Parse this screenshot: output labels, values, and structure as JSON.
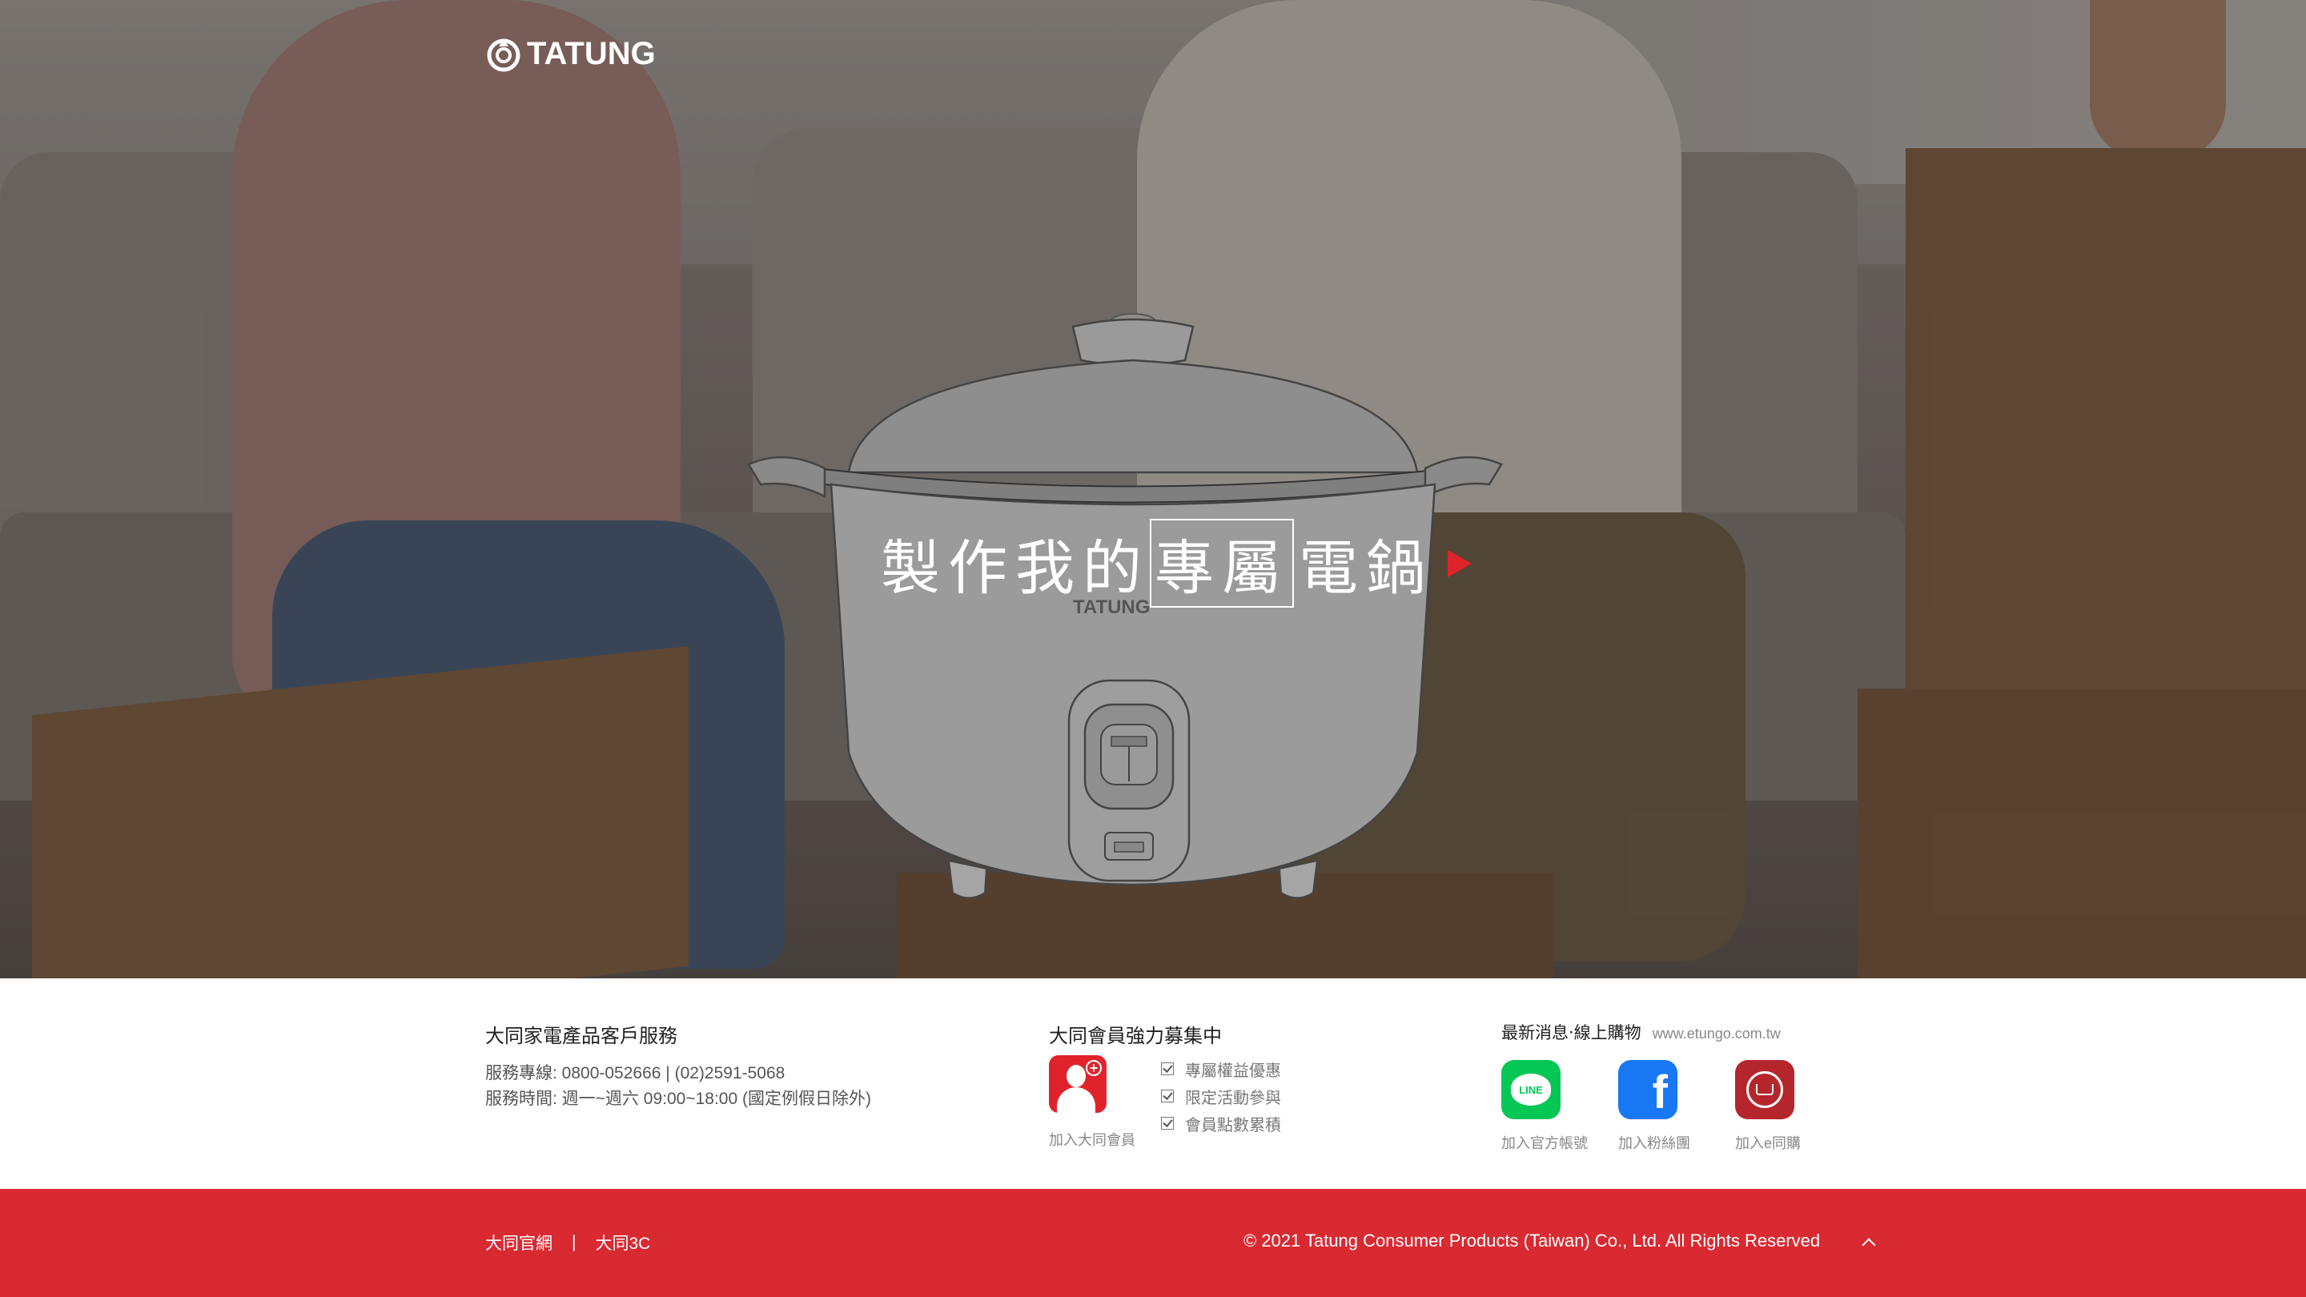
{
  "brand": {
    "name": "TATUNG"
  },
  "hero": {
    "title_prefix": "製作我的",
    "title_highlight": "專屬",
    "title_suffix": "電鍋",
    "cooker_logo": "TATUNG",
    "cta_icon": "play-triangle-icon"
  },
  "service": {
    "title": "大同家電產品客戶服務",
    "hotline": "服務專線: 0800-052666 | (02)2591-5068",
    "hours": "服務時間: 週一~週六 09:00~18:00 (國定例假日除外)"
  },
  "membership": {
    "title": "大同會員強力募集中",
    "join_label": "加入大同會員",
    "perks": [
      "專屬權益優惠",
      "限定活動參與",
      "會員點數累積"
    ]
  },
  "social": {
    "title": "最新消息‧線上購物",
    "url": "www.etungo.com.tw",
    "items": [
      {
        "label": "加入官方帳號",
        "icon": "line-icon"
      },
      {
        "label": "加入粉絲團",
        "icon": "facebook-icon"
      },
      {
        "label": "加入e同購",
        "icon": "shopping-cart-icon"
      }
    ]
  },
  "footer": {
    "links": [
      "大同官網",
      "大同3C"
    ],
    "separator": "|",
    "copyright": "© 2021 Tatung Consumer Products (Taiwan) Co., Ltd. All Rights Reserved"
  },
  "colors": {
    "brand_red": "#d92a32",
    "line_green": "#06c755",
    "facebook_blue": "#1877f2",
    "shop_red": "#b5262c"
  }
}
